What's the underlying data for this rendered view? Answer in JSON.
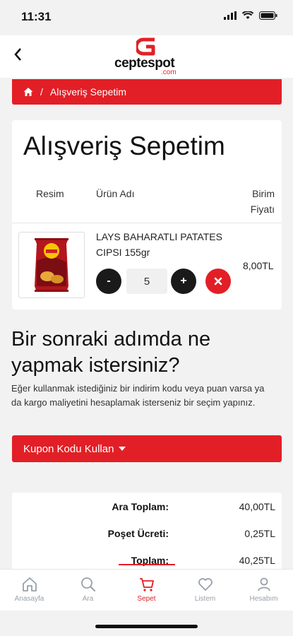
{
  "status_bar": {
    "time": "11:31",
    "icons": [
      "location-arrow-icon",
      "signal-icon",
      "wifi-icon",
      "battery-icon"
    ]
  },
  "header": {
    "back_icon": "chevron-left-icon",
    "logo_text": "ceptespot",
    "logo_sub": ".com"
  },
  "breadcrumb": {
    "home_icon": "home-icon",
    "separator": "/",
    "current": "Alışveriş Sepetim"
  },
  "cart": {
    "title": "Alışveriş Sepetim",
    "columns": {
      "image": "Resim",
      "product": "Ürün Adı",
      "price_line1": "Birim",
      "price_line2": "Fiyatı"
    },
    "items": [
      {
        "name": "LAYS BAHARATLI PATATES CIPSI 155gr",
        "quantity": "5",
        "decrement": "-",
        "increment": "+",
        "remove_icon": "close-icon",
        "unit_price": "8,00TL"
      }
    ]
  },
  "next_step": {
    "title": "Bir sonraki adımda ne yapmak istersiniz?",
    "description": "Eğer kullanmak istediğiniz bir indirim kodu veya puan varsa ya da kargo maliyetini hesaplamak isterseniz bir seçim yapınız.",
    "coupon_label": "Kupon Kodu Kullan"
  },
  "totals": [
    {
      "label": "Ara Toplam:",
      "value": "40,00TL"
    },
    {
      "label": "Poşet Ücreti:",
      "value": "0,25TL"
    },
    {
      "label": "Toplam:",
      "value": "40,25TL"
    }
  ],
  "bottom_nav": {
    "items": [
      {
        "label": "Anasayfa",
        "icon": "home-icon"
      },
      {
        "label": "Ara",
        "icon": "search-icon"
      },
      {
        "label": "Sepet",
        "icon": "cart-icon",
        "active": true
      },
      {
        "label": "Listem",
        "icon": "heart-icon"
      },
      {
        "label": "Hesabım",
        "icon": "user-icon"
      }
    ]
  },
  "colors": {
    "brand_red": "#e21f26",
    "background": "#f2f2f2",
    "dark_button": "#1a1a1a"
  }
}
